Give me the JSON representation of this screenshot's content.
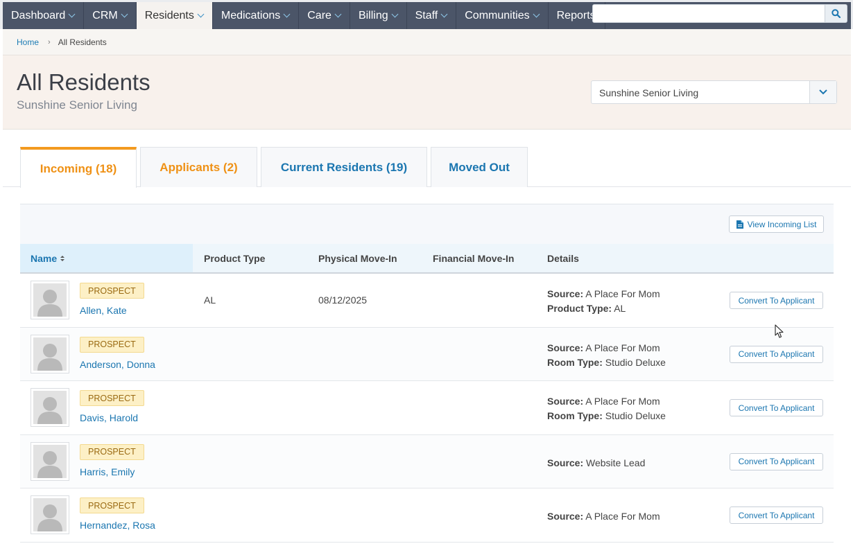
{
  "nav": {
    "items": [
      {
        "label": "Dashboard",
        "chevron": true,
        "active": false
      },
      {
        "label": "CRM",
        "chevron": true,
        "active": false
      },
      {
        "label": "Residents",
        "chevron": true,
        "active": true
      },
      {
        "label": "Medications",
        "chevron": true,
        "active": false
      },
      {
        "label": "Care",
        "chevron": true,
        "active": false
      },
      {
        "label": "Billing",
        "chevron": true,
        "active": false
      },
      {
        "label": "Staff",
        "chevron": true,
        "active": false
      },
      {
        "label": "Communities",
        "chevron": true,
        "active": false
      },
      {
        "label": "Reports",
        "chevron": false,
        "active": false
      }
    ],
    "search_value": "",
    "search_icon": "search-icon",
    "colors": {
      "bar": "#4b5568",
      "active_bg": "#f5f2ef",
      "chevron": "#8ec8ea"
    }
  },
  "breadcrumb": {
    "home": "Home",
    "separator": "›",
    "current": "All Residents"
  },
  "header": {
    "title": "All Residents",
    "subtitle": "Sunshine Senior Living",
    "community_select": "Sunshine Senior Living"
  },
  "tabs": [
    {
      "label": "Incoming  (18)",
      "active": true,
      "color": "#ef9115"
    },
    {
      "label": "Applicants  (2)",
      "active": false,
      "color": "#ef9115"
    },
    {
      "label": "Current Residents  (19)",
      "active": false,
      "color": "#1b76b0"
    },
    {
      "label": "Moved Out",
      "active": false,
      "color": "#1b76b0"
    }
  ],
  "toolbar": {
    "view_list": "View Incoming List",
    "view_list_icon": "document-icon"
  },
  "table": {
    "columns": {
      "name": "Name",
      "product_type": "Product Type",
      "physical_move_in": "Physical Move-In",
      "financial_move_in": "Financial Move-In",
      "details": "Details"
    },
    "sort_icon": "sort-icon",
    "rows": [
      {
        "badge": "PROSPECT",
        "name": "Allen, Kate",
        "product_type": "AL",
        "physical_move_in": "08/12/2025",
        "financial_move_in": "",
        "details": [
          {
            "label": "Source:",
            "value": "A Place For Mom"
          },
          {
            "label": "Product Type:",
            "value": "AL"
          }
        ],
        "action": "Convert To Applicant"
      },
      {
        "badge": "PROSPECT",
        "name": "Anderson, Donna",
        "product_type": "",
        "physical_move_in": "",
        "financial_move_in": "",
        "details": [
          {
            "label": "Source:",
            "value": "A Place For Mom"
          },
          {
            "label": "Room Type:",
            "value": "Studio Deluxe"
          }
        ],
        "action": "Convert To Applicant"
      },
      {
        "badge": "PROSPECT",
        "name": "Davis, Harold",
        "product_type": "",
        "physical_move_in": "",
        "financial_move_in": "",
        "details": [
          {
            "label": "Source:",
            "value": "A Place For Mom"
          },
          {
            "label": "Room Type:",
            "value": "Studio Deluxe"
          }
        ],
        "action": "Convert To Applicant"
      },
      {
        "badge": "PROSPECT",
        "name": "Harris, Emily",
        "product_type": "",
        "physical_move_in": "",
        "financial_move_in": "",
        "details": [
          {
            "label": "Source:",
            "value": "Website Lead"
          }
        ],
        "action": "Convert To Applicant"
      },
      {
        "badge": "PROSPECT",
        "name": "Hernandez, Rosa",
        "product_type": "",
        "physical_move_in": "",
        "financial_move_in": "",
        "details": [
          {
            "label": "Source:",
            "value": "A Place For Mom"
          }
        ],
        "action": "Convert To Applicant"
      }
    ]
  }
}
